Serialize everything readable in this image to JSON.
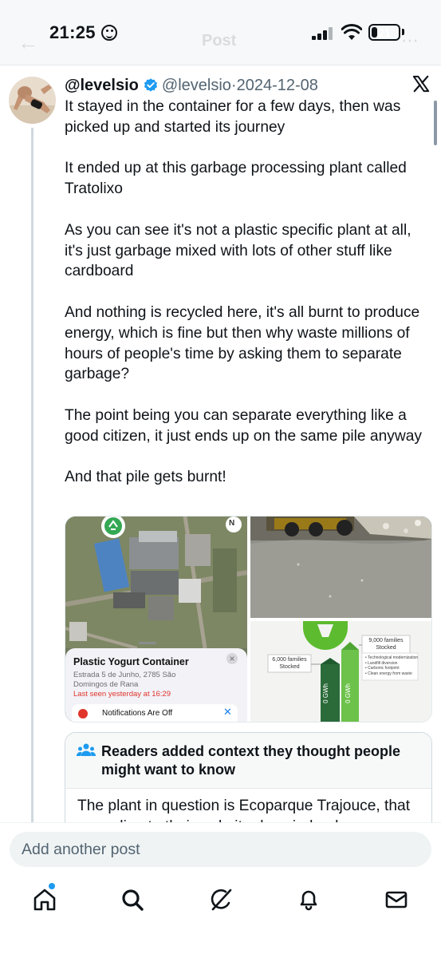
{
  "status_bar": {
    "time": "21:25",
    "battery": "21",
    "battery_level": 0.21
  },
  "header": {
    "back_label": "←",
    "title": "Post",
    "more_label": "⋯"
  },
  "post": {
    "display_name": "@levelsio",
    "handle": "@levelsio",
    "separator": "·",
    "date": "2024-12-08",
    "paragraphs": [
      "It stayed in the container for a few days, then was picked up and started its journey",
      "It ended up at this garbage processing plant called Tratolixo",
      "As you can see it's not a plastic specific plant at all, it's just garbage mixed with lots of other stuff like cardboard",
      "And nothing is recycled here, it's all burnt to produce energy, which is fine but then why waste millions of hours of people's time by asking them to separate garbage?",
      "The point being you can separate everything like a good citizen, it just ends up on the same pile anyway",
      "And that pile gets burnt!"
    ]
  },
  "media": {
    "map_card": {
      "title": "Plastic Yogurt Container",
      "address": "Estrada 5 de Junho, 2785 São Domingos de Rana",
      "last_seen": "Last seen yesterday at 16:29",
      "close_label": "×",
      "notifications": "Notifications Are Off",
      "compass": "N"
    },
    "infographic": {
      "label_small": "6,000 families Stocked",
      "label_large": "9,000 families Stocked",
      "bar_unit": "0 GWh",
      "bar_unit_2": "0 GWh",
      "bullets": [
        "• Technological modernization",
        "• Landfill diversion",
        "• Carbonic footprint",
        "• Clean energy from waste"
      ]
    }
  },
  "community_note": {
    "title": "Readers added context they thought people might want to know",
    "text": "The plant in question is Ecoparque Trajouce, that according to their website does indeed"
  },
  "reply": {
    "placeholder": "Add another post"
  },
  "tabs": [
    "home",
    "search",
    "grok",
    "notifications",
    "messages"
  ],
  "colors": {
    "accent": "#1d9bf0",
    "text": "#0f1419",
    "muted": "#536471",
    "border": "#cfd9de"
  }
}
